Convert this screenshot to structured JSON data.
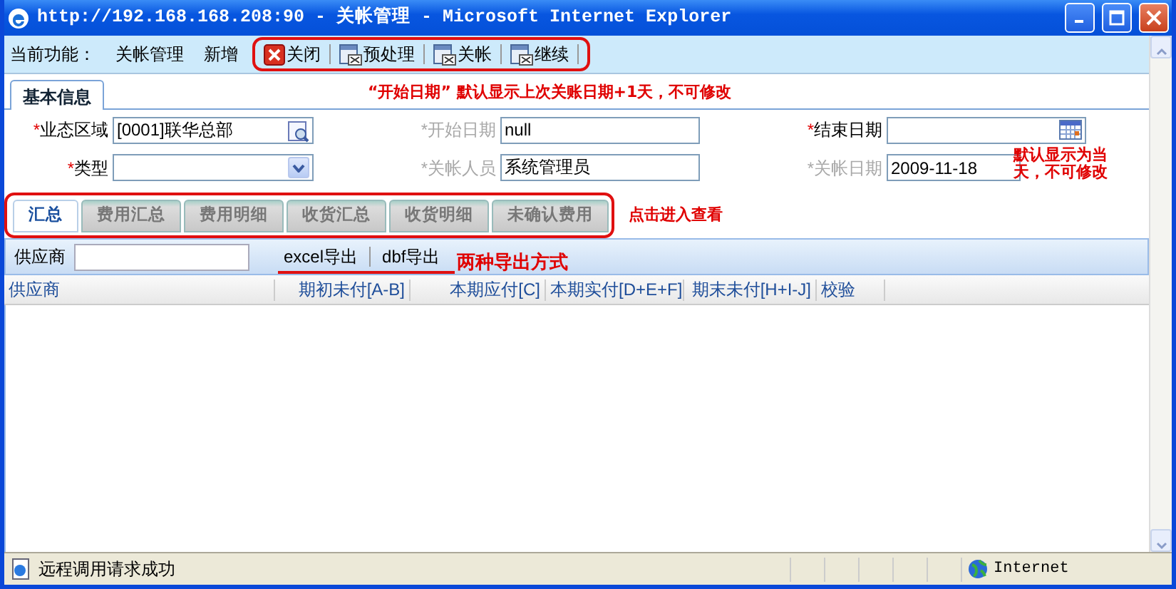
{
  "window": {
    "title": "http://192.168.168.208:90 - 关帐管理 - Microsoft Internet Explorer"
  },
  "function_bar": {
    "label": "当前功能：",
    "items": [
      "关帐管理",
      "新增"
    ]
  },
  "toolbar": [
    {
      "label": "关闭",
      "kind": "close"
    },
    {
      "label": "预处理",
      "kind": "form"
    },
    {
      "label": "关帐",
      "kind": "form"
    },
    {
      "label": "继续",
      "kind": "form"
    }
  ],
  "main_tabs": [
    {
      "label": "基本信息",
      "selected": true
    }
  ],
  "notes": {
    "start_date": "“开始日期” 默认显示上次关账日期+1天，不可修改",
    "close_date": "默认显示为当天，不可修改",
    "tabs": "点击进入查看",
    "export": "两种导出方式"
  },
  "form": [
    {
      "marker": "*",
      "label": "业态区域",
      "disabled": false,
      "kind": "lookup",
      "value": "[0001]联华总部"
    },
    {
      "marker": "*",
      "label": "开始日期",
      "disabled": true,
      "kind": "text",
      "value": "null"
    },
    {
      "marker": "*",
      "label": "结束日期",
      "disabled": false,
      "kind": "date"
    },
    {
      "marker": "*",
      "label": "类型",
      "disabled": false,
      "kind": "select"
    },
    {
      "marker": "*",
      "label": "关帐人员",
      "disabled": true,
      "kind": "text",
      "value": "系统管理员"
    },
    {
      "marker": "*",
      "label": "关帐日期",
      "disabled": true,
      "kind": "text",
      "value": "2009-11-18"
    }
  ],
  "sub_tabs": [
    {
      "label": "汇总",
      "selected": true
    },
    {
      "label": "费用汇总",
      "selected": false
    },
    {
      "label": "费用明细",
      "selected": false
    },
    {
      "label": "收货汇总",
      "selected": false
    },
    {
      "label": "收货明细",
      "selected": false
    },
    {
      "label": "未确认费用",
      "selected": false
    }
  ],
  "filter": {
    "label": "供应商"
  },
  "exports": [
    "excel导出",
    "dbf导出"
  ],
  "table": {
    "columns": [
      "供应商",
      "期初未付[A-B]",
      "本期应付[C]",
      "本期实付[D+E+F]",
      "期末未付[H+I-J]",
      "校验"
    ]
  },
  "status_bar": {
    "message": "远程调用请求成功",
    "zone": "Internet"
  }
}
